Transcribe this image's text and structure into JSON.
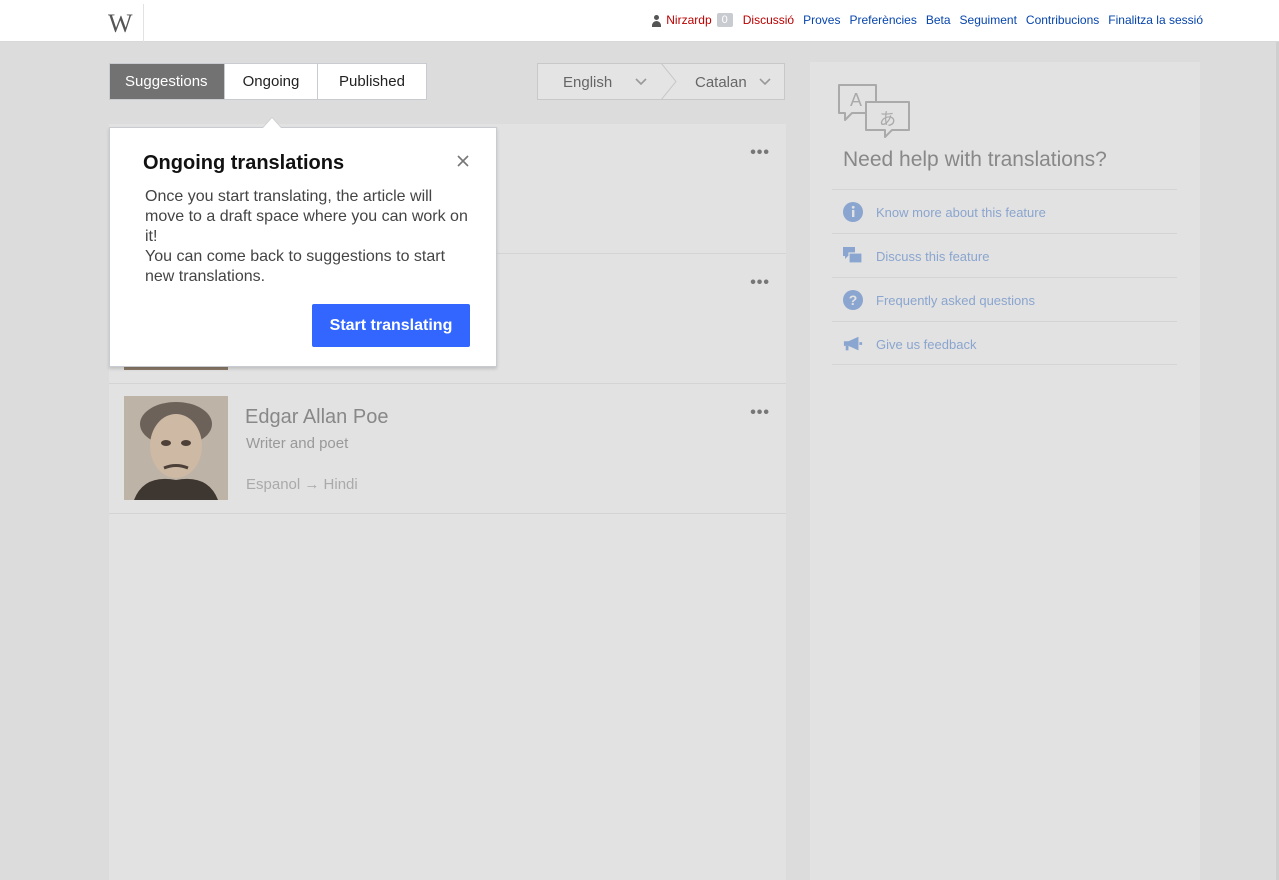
{
  "logo": {
    "glyph": "W"
  },
  "personal_tools": {
    "username": "Nirzardp",
    "notifications": "0",
    "talk": "Discussió",
    "sandbox": "Proves",
    "preferences": "Preferències",
    "beta": "Beta",
    "watchlist": "Seguiment",
    "contributions": "Contribucions",
    "logout": "Finalitza la sessió"
  },
  "tabs": {
    "suggestions": "Suggestions",
    "ongoing": "Ongoing",
    "published": "Published"
  },
  "language_selector": {
    "source": "English",
    "target": "Catalan"
  },
  "suggestions": [
    {
      "title": "",
      "description": "",
      "languages": ""
    },
    {
      "title": "",
      "description": "",
      "languages": ""
    },
    {
      "title": "Edgar Allan Poe",
      "description": "Writer and poet",
      "languages": "Espanol → Hindi"
    }
  ],
  "more_glyph": "•••",
  "help": {
    "title": "Need help with translations?",
    "items": [
      {
        "label": "Know more about this feature",
        "icon": "info-icon"
      },
      {
        "label": "Discuss this feature",
        "icon": "discussion-icon"
      },
      {
        "label": "Frequently asked questions",
        "icon": "help-icon"
      },
      {
        "label": "Give us feedback",
        "icon": "megaphone-icon"
      }
    ],
    "link_color": "#8aa5cf"
  },
  "popup": {
    "title": "Ongoing translations",
    "paragraph1": "Once you start translating, the article will move to a draft space where you can work on it!",
    "paragraph2": "You can come back to suggestions to start new translations.",
    "button": "Start translating",
    "button_color": "#3366ff"
  },
  "colors": {
    "link_blue": "#0645ad",
    "link_red": "#ba0000",
    "overlay_gray": "#dcdcdc",
    "active_tab": "#727272"
  }
}
